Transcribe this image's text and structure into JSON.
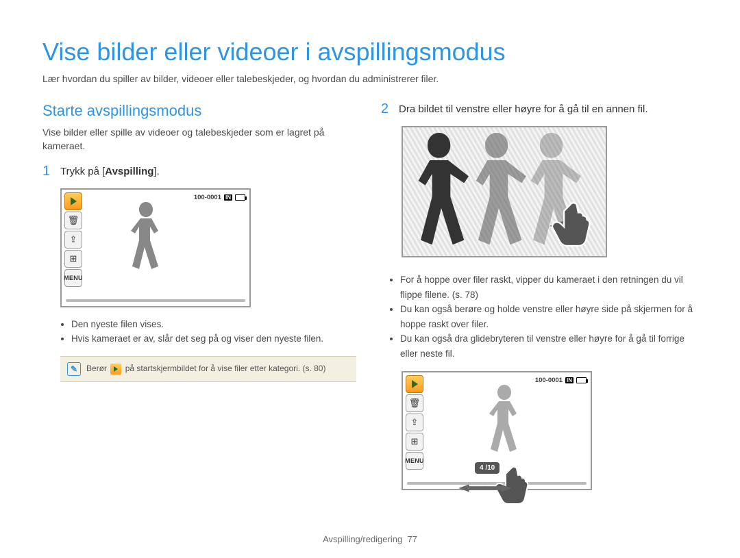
{
  "title": "Vise bilder eller videoer i avspillingsmodus",
  "intro": "Lær hvordan du spiller av bilder, videoer eller talebeskjeder, og hvordan du administrerer filer.",
  "left": {
    "heading": "Starte avspillingsmodus",
    "desc": "Vise bilder eller spille av videoer og talebeskjeder som er lagret på kameraet.",
    "step1": {
      "num": "1",
      "pre": "Trykk på [",
      "bold": "Avspilling",
      "post": "]."
    },
    "shot": {
      "filecode": "100-0001",
      "storage": "IN",
      "menu": "MENU"
    },
    "bullets": [
      "Den nyeste filen vises.",
      "Hvis kameraet er av, slår det seg på og viser den nyeste filen."
    ],
    "note": {
      "pre": "Berør ",
      "post": " på startskjermbildet for å vise filer etter kategori. (s. 80)"
    }
  },
  "right": {
    "step2": {
      "num": "2",
      "text": "Dra bildet til venstre eller høyre for å gå til en annen fil."
    },
    "bullets": [
      "For å hoppe over filer raskt, vipper du kameraet i den retningen du vil flippe filene. (s. 78)",
      "Du kan også berøre og holde venstre eller høyre side på skjermen for å hoppe raskt over filer.",
      "Du kan også dra glidebryteren til venstre eller høyre for å gå til forrige eller neste fil."
    ],
    "shot2": {
      "filecode": "100-0001",
      "storage": "IN",
      "menu": "MENU",
      "counter": "4 /10"
    }
  },
  "footer": {
    "section": "Avspilling/redigering",
    "page": "77"
  },
  "icons": {
    "trash": "🗑",
    "share": "⇪",
    "grid": "⊞",
    "note": "✎"
  }
}
